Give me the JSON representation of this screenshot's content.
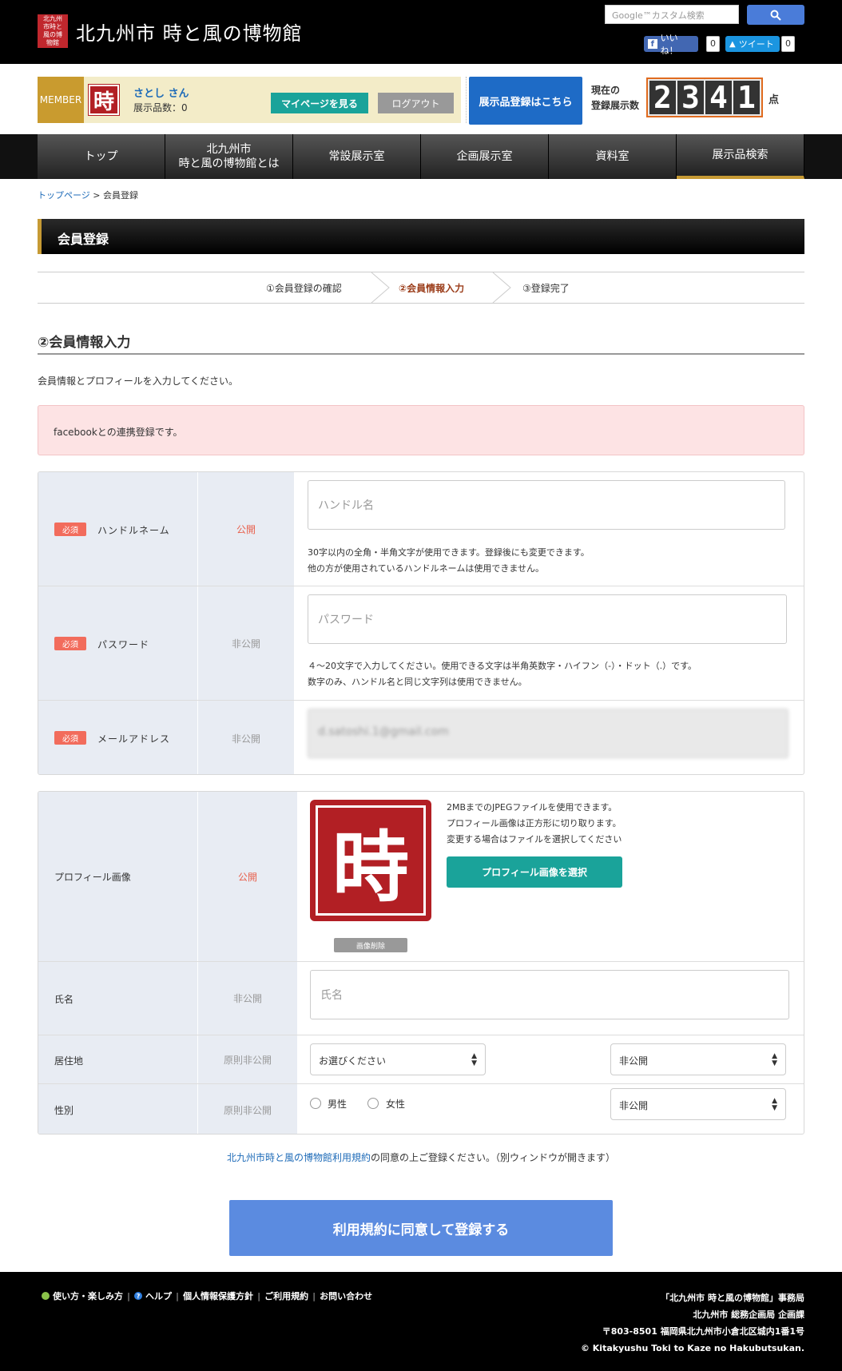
{
  "header": {
    "logo_text": "北九州市時と風の博物館",
    "site_title": "北九州市 時と風の博物館",
    "search_placeholder": "Google™カスタム検索",
    "fb_like": "いいね！",
    "fb_count": "0",
    "tweet": "ツイート",
    "tweet_count": "0"
  },
  "member": {
    "tag": "MEMBER",
    "avatar_char": "時",
    "name": "さとし さん",
    "exhibits": "展示品数：0",
    "mypage": "マイページを見る",
    "logout": "ログアウト"
  },
  "exhibit_register": "展示品登録はこちら",
  "registered": {
    "label_line1": "現在の",
    "label_line2": "登録展示数",
    "digits": [
      "2",
      "3",
      "4",
      "1"
    ],
    "unit": "点"
  },
  "nav": [
    {
      "label": "トップ"
    },
    {
      "label": "北九州市\n時と風の博物館とは"
    },
    {
      "label": "常設展示室"
    },
    {
      "label": "企画展示室"
    },
    {
      "label": "資料室"
    },
    {
      "label": "展示品検索"
    }
  ],
  "breadcrumb": {
    "home": "トップページ",
    "sep": ">",
    "current": "会員登録"
  },
  "page_title": "会員登録",
  "steps": [
    "①会員登録の確認",
    "②会員情報入力",
    "③登録完了"
  ],
  "section_title": "②会員情報入力",
  "intro": "会員情報とプロフィールを入力してください。",
  "notice": "facebookとの連携登録です。",
  "required": "必須",
  "visibility": {
    "public": "公開",
    "private": "非公開",
    "default_private": "原則非公開"
  },
  "fields": {
    "handle": {
      "label": "ハンドルネーム",
      "placeholder": "ハンドル名",
      "help1": "30字以内の全角・半角文字が使用できます。登録後にも変更できます。",
      "help2": "他の方が使用されているハンドルネームは使用できません。"
    },
    "password": {
      "label": "パスワード",
      "placeholder": "パスワード",
      "help1": "４～20文字で入力してください。使用できる文字は半角英数字・ハイフン（-）・ドット（.）です。",
      "help2": "数字のみ、ハンドル名と同じ文字列は使用できません。"
    },
    "email": {
      "label": "メールアドレス",
      "value": "d.satoshi.1@gmail.com"
    },
    "profile": {
      "label": "プロフィール画像",
      "image_char": "時",
      "delete": "画像削除",
      "help1": "2MBまでのJPEGファイルを使用できます。",
      "help2": "プロフィール画像は正方形に切り取ります。",
      "help3": "変更する場合はファイルを選択してください",
      "select": "プロフィール画像を選択"
    },
    "name": {
      "label": "氏名",
      "placeholder": "氏名"
    },
    "residence": {
      "label": "居住地",
      "select": "お選びください",
      "visibility_select": "非公開"
    },
    "gender": {
      "label": "性別",
      "male": "男性",
      "female": "女性",
      "visibility_select": "非公開"
    }
  },
  "terms": {
    "link": "北九州市時と風の博物館利用規約",
    "text": "の同意の上ご登録ください。（別ウィンドウが開きます）"
  },
  "submit": "利用規約に同意して登録する",
  "footer": {
    "links": [
      "使い方・楽しみ方",
      "ヘルプ",
      "個人情報保護方針",
      "ご利用規約",
      "お問い合わせ"
    ],
    "info1": "「北九州市 時と風の博物館」事務局",
    "info2": "北九州市 総務企画局 企画課",
    "info3": "〒803-8501 福岡県北九州市小倉北区城内1番1号",
    "info4": "© Kitakyushu Toki to Kaze no Hakubutsukan."
  }
}
